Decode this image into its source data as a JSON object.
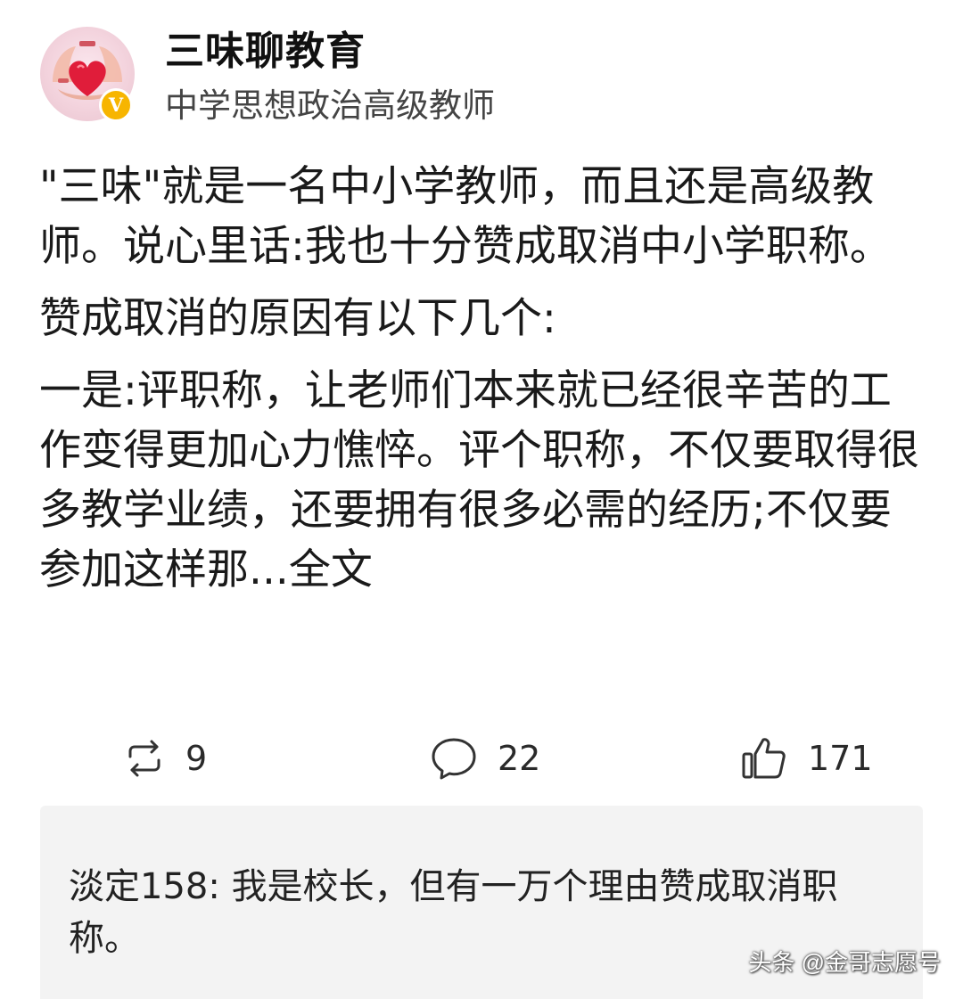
{
  "author": {
    "name": "三味聊教育",
    "title": "中学思想政治高级教师",
    "verified_badge": "V",
    "avatar_icon": "heart-in-hands-icon",
    "accent_color": "#f7b500"
  },
  "post": {
    "paragraphs": [
      "\"三味\"就是一名中小学教师，而且还是高级教师。说心里话:我也十分赞成取消中小学职称。",
      "赞成取消的原因有以下几个:",
      "一是:评职称，让老师们本来就已经很辛苦的工作变得更加心力憔悴。评个职称，不仅要取得很多教学业绩，还要拥有很多必需的经历;不仅要参加这样那..."
    ],
    "full_text_link": "全文",
    "link_color": "#1a1a1a"
  },
  "actions": {
    "repost": {
      "icon": "repost-icon",
      "count": "9"
    },
    "comment": {
      "icon": "comment-bubble-icon",
      "count": "22"
    },
    "like": {
      "icon": "thumbs-up-icon",
      "count": "171"
    }
  },
  "top_comment": {
    "user": "淡定158",
    "separator": ": ",
    "text": "我是校长，但有一万个理由赞成取消职称。"
  },
  "watermark": "头条 @金哥志愿号"
}
